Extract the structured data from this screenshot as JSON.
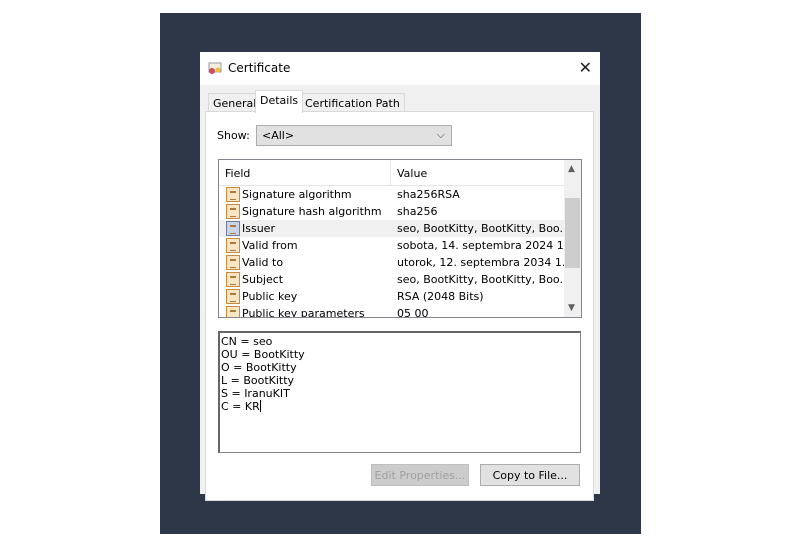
{
  "window": {
    "title": "Certificate",
    "close_icon": "close-icon"
  },
  "tabs": [
    {
      "label": "General"
    },
    {
      "label": "Details",
      "active": true
    },
    {
      "label": "Certification Path"
    }
  ],
  "show": {
    "label": "Show:",
    "value": "<All>"
  },
  "list": {
    "columns": [
      "Field",
      "Value"
    ],
    "rows": [
      {
        "field": "Signature algorithm",
        "value": "sha256RSA"
      },
      {
        "field": "Signature hash algorithm",
        "value": "sha256"
      },
      {
        "field": "Issuer",
        "value": "seo, BootKitty, BootKitty, Boo...",
        "selected": true
      },
      {
        "field": "Valid from",
        "value": "sobota, 14. septembra 2024 1..."
      },
      {
        "field": "Valid to",
        "value": "utorok, 12. septembra 2034 1..."
      },
      {
        "field": "Subject",
        "value": "seo, BootKitty, BootKitty, Boo..."
      },
      {
        "field": "Public key",
        "value": "RSA (2048 Bits)"
      },
      {
        "field": "Public key parameters",
        "value": "05 00"
      }
    ]
  },
  "detail": [
    "CN = seo",
    "OU = BootKitty",
    "O = BootKitty",
    "L = BootKitty",
    "S = IranuKIT",
    "C = KR"
  ],
  "buttons": {
    "edit": "Edit Properties...",
    "copy": "Copy to File..."
  },
  "colors": {
    "backdrop": "#2e3748",
    "selection": "#f0f0f0"
  }
}
